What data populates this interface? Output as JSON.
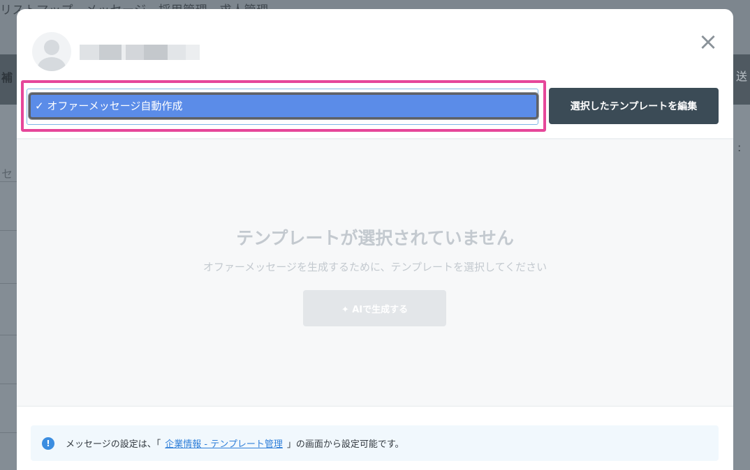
{
  "background": {
    "nav_text": "リストマップ　メッセージ　採用管理　求人管理",
    "left_fragment_1": "補",
    "left_fragment_2": "セ",
    "right_fragment_1": "送",
    "right_fragment_2": ":"
  },
  "modal": {
    "select": {
      "selected_label": "✓ オファーメッセージ自動作成"
    },
    "edit_button_label": "選択したテンプレートを編集",
    "close_icon": "×",
    "empty_state": {
      "title": "テンプレートが選択されていません",
      "subtitle": "オファーメッセージを生成するために、テンプレートを選択してください",
      "generate_button_label": "✦ AIで生成する"
    },
    "info": {
      "icon": "!",
      "prefix": "メッセージの設定は、「",
      "link_label": "企業情報 - テンプレート管理",
      "suffix": "」の画面から設定可能です。"
    }
  },
  "colors": {
    "highlight": "#e6479a",
    "selected_option": "#5b8ce8",
    "primary_button": "#3b4b56",
    "info_icon": "#3b8de0",
    "link": "#2f7fd9"
  }
}
